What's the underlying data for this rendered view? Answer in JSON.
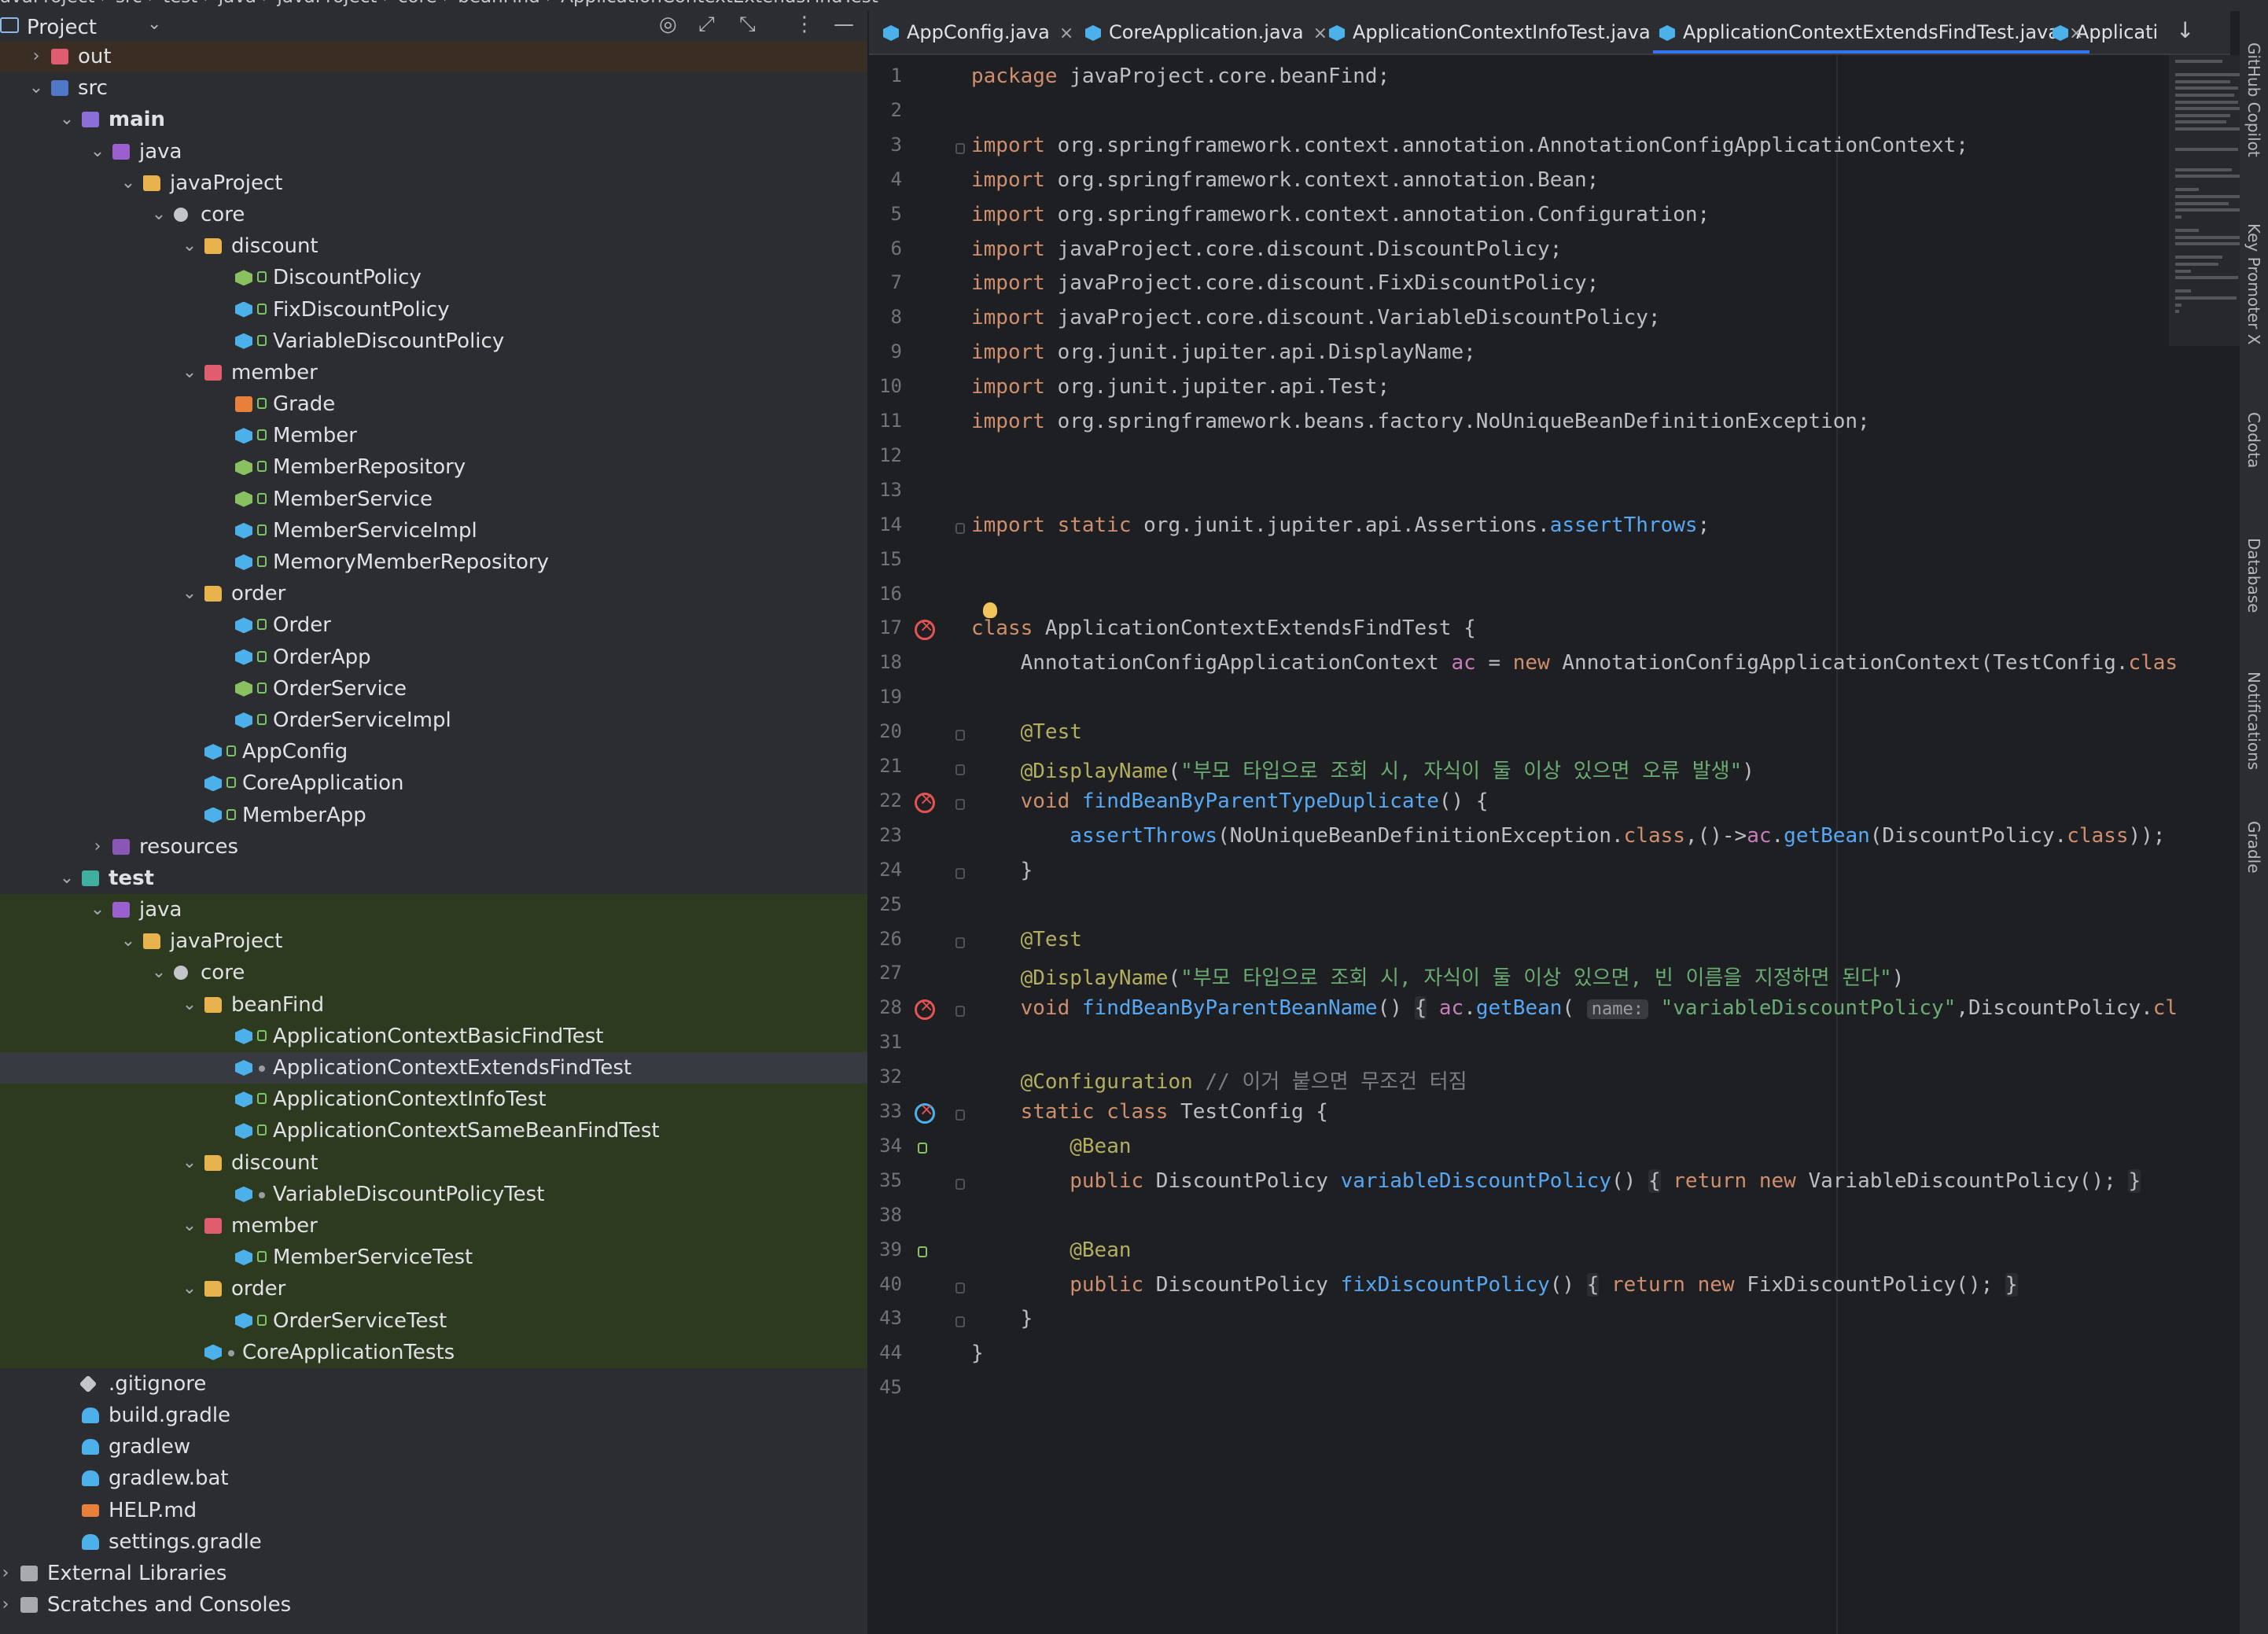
{
  "breadcrumbs": [
    "avaProject",
    "src",
    "test",
    "java",
    "javaProject",
    "core",
    "beanFind",
    "ApplicationContextExtendsFindTest"
  ],
  "project_panel": {
    "title": "Project",
    "icons": [
      "target-icon",
      "expand-icon",
      "collapse-icon",
      "more-icon",
      "minimize-icon"
    ]
  },
  "tree": [
    {
      "label": "out",
      "depth": 1,
      "chev": "›",
      "icon": "folder-red",
      "row": "hl"
    },
    {
      "label": "src",
      "depth": 1,
      "chev": "⌄",
      "icon": "folder-src"
    },
    {
      "label": "main",
      "depth": 2,
      "chev": "⌄",
      "icon": "folder-main",
      "bold": true
    },
    {
      "label": "java",
      "depth": 3,
      "chev": "⌄",
      "icon": "folder-java"
    },
    {
      "label": "javaProject",
      "depth": 4,
      "chev": "⌄",
      "icon": "folder"
    },
    {
      "label": "core",
      "depth": 5,
      "chev": "⌄",
      "icon": "pkg"
    },
    {
      "label": "discount",
      "depth": 6,
      "chev": "⌄",
      "icon": "folder"
    },
    {
      "label": "DiscountPolicy",
      "depth": 7,
      "icon": "iface",
      "lock": true
    },
    {
      "label": "FixDiscountPolicy",
      "depth": 7,
      "icon": "cls",
      "lock": true
    },
    {
      "label": "VariableDiscountPolicy",
      "depth": 7,
      "icon": "cls",
      "lock": true
    },
    {
      "label": "member",
      "depth": 6,
      "chev": "⌄",
      "icon": "folder-red"
    },
    {
      "label": "Grade",
      "depth": 7,
      "icon": "enum",
      "lock": true
    },
    {
      "label": "Member",
      "depth": 7,
      "icon": "cls",
      "lock": true
    },
    {
      "label": "MemberRepository",
      "depth": 7,
      "icon": "iface",
      "lock": true
    },
    {
      "label": "MemberService",
      "depth": 7,
      "icon": "iface",
      "lock": true
    },
    {
      "label": "MemberServiceImpl",
      "depth": 7,
      "icon": "cls",
      "lock": true
    },
    {
      "label": "MemoryMemberRepository",
      "depth": 7,
      "icon": "cls",
      "lock": true
    },
    {
      "label": "order",
      "depth": 6,
      "chev": "⌄",
      "icon": "folder"
    },
    {
      "label": "Order",
      "depth": 7,
      "icon": "cls",
      "lock": true
    },
    {
      "label": "OrderApp",
      "depth": 7,
      "icon": "cls",
      "lock": true
    },
    {
      "label": "OrderService",
      "depth": 7,
      "icon": "iface",
      "lock": true
    },
    {
      "label": "OrderServiceImpl",
      "depth": 7,
      "icon": "cls",
      "lock": true
    },
    {
      "label": "AppConfig",
      "depth": 6,
      "icon": "cls",
      "lock": true
    },
    {
      "label": "CoreApplication",
      "depth": 6,
      "icon": "cls",
      "lock": true
    },
    {
      "label": "MemberApp",
      "depth": 6,
      "icon": "cls",
      "lock": true
    },
    {
      "label": "resources",
      "depth": 3,
      "chev": "›",
      "icon": "folder-res"
    },
    {
      "label": "test",
      "depth": 2,
      "chev": "⌄",
      "icon": "folder-test",
      "bold": true
    },
    {
      "label": "java",
      "depth": 3,
      "chev": "⌄",
      "icon": "folder-java",
      "row": "green"
    },
    {
      "label": "javaProject",
      "depth": 4,
      "chev": "⌄",
      "icon": "folder",
      "row": "green"
    },
    {
      "label": "core",
      "depth": 5,
      "chev": "⌄",
      "icon": "pkg",
      "row": "green"
    },
    {
      "label": "beanFind",
      "depth": 6,
      "chev": "⌄",
      "icon": "folder",
      "row": "green"
    },
    {
      "label": "ApplicationContextBasicFindTest",
      "depth": 7,
      "icon": "cls",
      "lock": true,
      "row": "green"
    },
    {
      "label": "ApplicationContextExtendsFindTest",
      "depth": 7,
      "icon": "cls",
      "dot": true,
      "row": "sel"
    },
    {
      "label": "ApplicationContextInfoTest",
      "depth": 7,
      "icon": "cls",
      "lock": true,
      "row": "green"
    },
    {
      "label": "ApplicationContextSameBeanFindTest",
      "depth": 7,
      "icon": "cls",
      "lock": true,
      "row": "green"
    },
    {
      "label": "discount",
      "depth": 6,
      "chev": "⌄",
      "icon": "folder",
      "row": "green"
    },
    {
      "label": "VariableDiscountPolicyTest",
      "depth": 7,
      "icon": "cls",
      "dot": true,
      "row": "green"
    },
    {
      "label": "member",
      "depth": 6,
      "chev": "⌄",
      "icon": "folder-red",
      "row": "green"
    },
    {
      "label": "MemberServiceTest",
      "depth": 7,
      "icon": "cls",
      "lock": true,
      "row": "green"
    },
    {
      "label": "order",
      "depth": 6,
      "chev": "⌄",
      "icon": "folder",
      "row": "green"
    },
    {
      "label": "OrderServiceTest",
      "depth": 7,
      "icon": "cls",
      "lock": true,
      "row": "green"
    },
    {
      "label": "CoreApplicationTests",
      "depth": 6,
      "icon": "cls",
      "dot": true,
      "row": "green"
    },
    {
      "label": ".gitignore",
      "depth": 2,
      "icon": "file-git"
    },
    {
      "label": "build.gradle",
      "depth": 2,
      "icon": "file-gradle"
    },
    {
      "label": "gradlew",
      "depth": 2,
      "icon": "file-gradle"
    },
    {
      "label": "gradlew.bat",
      "depth": 2,
      "icon": "file-gradle"
    },
    {
      "label": "HELP.md",
      "depth": 2,
      "icon": "file-md"
    },
    {
      "label": "settings.gradle",
      "depth": 2,
      "icon": "file-gradle"
    },
    {
      "label": "External Libraries",
      "depth": 0,
      "chev": "›",
      "icon": "lib"
    },
    {
      "label": "Scratches and Consoles",
      "depth": 0,
      "chev": "›",
      "icon": "scratch"
    }
  ],
  "tabs": [
    {
      "label": "AppConfig.java",
      "active": false
    },
    {
      "label": "CoreApplication.java",
      "active": false
    },
    {
      "label": "ApplicationContextInfoTest.java",
      "active": false
    },
    {
      "label": "ApplicationContextExtendsFindTest.java",
      "active": true
    },
    {
      "label": "Applicati",
      "active": false,
      "clipped": true
    }
  ],
  "code_lines": [
    {
      "n": "1",
      "html": "<span class=\"kw\">package</span> javaProject.core.beanFind;"
    },
    {
      "n": "2",
      "html": ""
    },
    {
      "n": "3",
      "html": "<span class=\"kw\">import</span> org.springframework.context.annotation.AnnotationConfigApplicationContext;",
      "fold": true
    },
    {
      "n": "4",
      "html": "<span class=\"kw\">import</span> org.springframework.context.annotation.Bean;"
    },
    {
      "n": "5",
      "html": "<span class=\"kw\">import</span> org.springframework.context.annotation.Configuration;"
    },
    {
      "n": "6",
      "html": "<span class=\"kw\">import</span> javaProject.core.discount.DiscountPolicy;"
    },
    {
      "n": "7",
      "html": "<span class=\"kw\">import</span> javaProject.core.discount.FixDiscountPolicy;"
    },
    {
      "n": "8",
      "html": "<span class=\"kw\">import</span> javaProject.core.discount.VariableDiscountPolicy;"
    },
    {
      "n": "9",
      "html": "<span class=\"kw\">import</span> org.junit.jupiter.api.DisplayName;"
    },
    {
      "n": "10",
      "html": "<span class=\"kw\">import</span> org.junit.jupiter.api.Test;"
    },
    {
      "n": "11",
      "html": "<span class=\"kw\">import</span> org.springframework.beans.factory.NoUniqueBeanDefinitionException;"
    },
    {
      "n": "12",
      "html": ""
    },
    {
      "n": "13",
      "html": ""
    },
    {
      "n": "14",
      "html": "<span class=\"kw\">import static</span> org.junit.jupiter.api.Assertions.<span class=\"fn\">assertThrows</span>;",
      "fold": true
    },
    {
      "n": "15",
      "html": ""
    },
    {
      "n": "16",
      "html": ""
    },
    {
      "n": "17",
      "html": "<span class=\"kw\">class</span> ApplicationContextExtendsFindTest {",
      "err": true
    },
    {
      "n": "18",
      "html": "    AnnotationConfigApplicationContext <span class=\"fld\">ac</span> = <span class=\"kw\">new</span> AnnotationConfigApplicationContext(TestConfig.<span class=\"kw\">clas</span>"
    },
    {
      "n": "19",
      "html": ""
    },
    {
      "n": "20",
      "html": "    <span class=\"an\">@Test</span>",
      "fold": true
    },
    {
      "n": "21",
      "html": "    <span class=\"an\">@DisplayName</span>(<span class=\"st\">\"부모 타입으로 조회 시, 자식이 둘 이상 있으면 오류 발생\"</span>)",
      "fold": true
    },
    {
      "n": "22",
      "html": "    <span class=\"kw\">void</span> <span class=\"fn\">findBeanByParentTypeDuplicate</span>() {",
      "err": true,
      "fold": true
    },
    {
      "n": "23",
      "html": "        <span class=\"fn\">assertThrows</span>(NoUniqueBeanDefinitionException.<span class=\"kw\">class</span>,()-&gt;<span class=\"fld\">ac</span>.<span class=\"fn\">getBean</span>(DiscountPolicy.<span class=\"kw\">class</span>));"
    },
    {
      "n": "24",
      "html": "    }",
      "fold": true
    },
    {
      "n": "25",
      "html": ""
    },
    {
      "n": "26",
      "html": "    <span class=\"an\">@Test</span>",
      "fold": true
    },
    {
      "n": "27",
      "html": "    <span class=\"an\">@DisplayName</span>(<span class=\"st\">\"부모 타입으로 조회 시, 자식이 둘 이상 있으면, 빈 이름을 지정하면 된다\"</span>)"
    },
    {
      "n": "28",
      "html": "    <span class=\"kw\">void</span> <span class=\"fn\">findBeanByParentBeanName</span>() <span class=\"fold\">{</span> <span class=\"fld\">ac</span>.<span class=\"fn\">getBean</span>( <span class=\"hint\">name:</span> <span class=\"st\">\"variableDiscountPolicy\"</span>,DiscountPolicy.<span class=\"kw\">cl</span>",
      "err": true,
      "fold": true
    },
    {
      "n": "31",
      "html": ""
    },
    {
      "n": "32",
      "html": "    <span class=\"an\">@Configuration</span> <span class=\"cm\">// 이거 붙으면 무조건 터짐</span>"
    },
    {
      "n": "33",
      "html": "    <span class=\"kw\">static class</span> TestConfig {",
      "fold": true,
      "bean": true
    },
    {
      "n": "34",
      "html": "        <span class=\"an\">@Bean</span>",
      "beanm": true
    },
    {
      "n": "35",
      "html": "        <span class=\"kw\">public</span> DiscountPolicy <span class=\"fn\">variableDiscountPolicy</span>() <span class=\"fold\">{</span> <span class=\"kw\">return new</span> VariableDiscountPolicy(); <span class=\"fold\">}</span>",
      "fold": true
    },
    {
      "n": "38",
      "html": ""
    },
    {
      "n": "39",
      "html": "        <span class=\"an\">@Bean</span>",
      "beanm": true
    },
    {
      "n": "40",
      "html": "        <span class=\"kw\">public</span> DiscountPolicy <span class=\"fn\">fixDiscountPolicy</span>() <span class=\"fold\">{</span> <span class=\"kw\">return new</span> FixDiscountPolicy(); <span class=\"fold\">}</span>",
      "fold": true
    },
    {
      "n": "43",
      "html": "    }",
      "fold": true
    },
    {
      "n": "44",
      "html": "}"
    },
    {
      "n": "45",
      "html": ""
    }
  ],
  "right_toolbar": [
    "GitHub Copilot",
    "Key Promoter X",
    "Codota",
    "Database",
    "Notifications",
    "Gradle"
  ]
}
